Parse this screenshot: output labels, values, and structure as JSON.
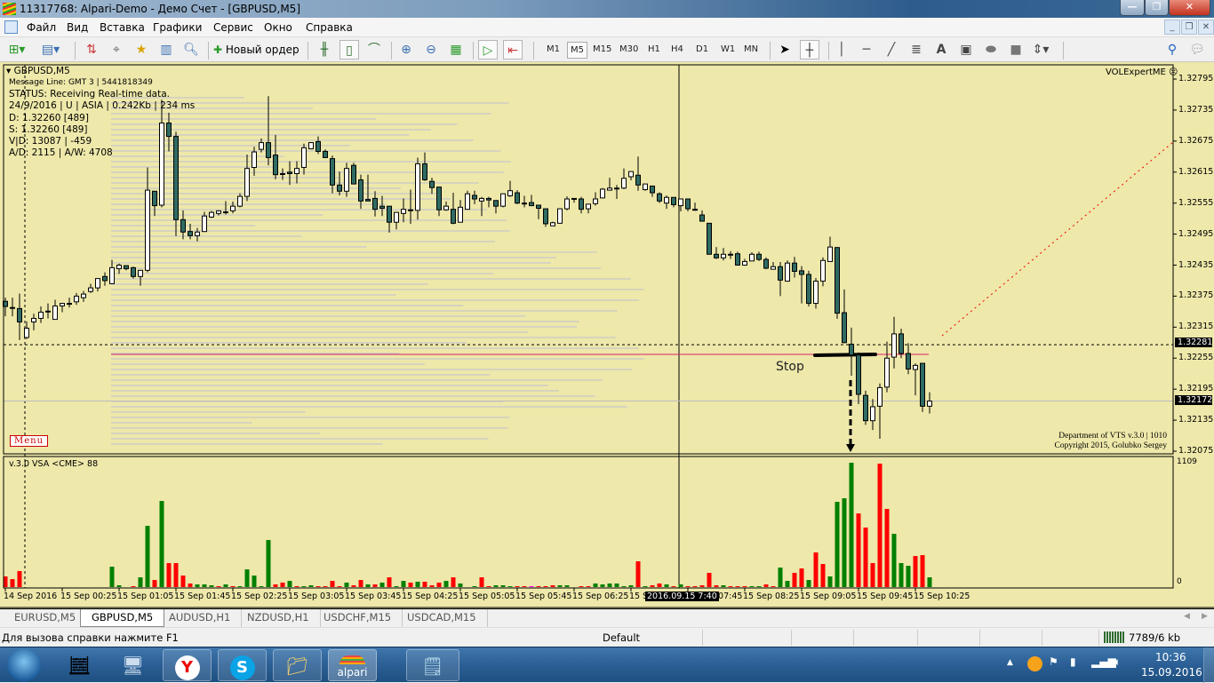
{
  "window": {
    "title": "11317768: Alpari-Demo - Демо Счет - [GBPUSD,M5]"
  },
  "menu": [
    "Файл",
    "Вид",
    "Вставка",
    "Графики",
    "Сервис",
    "Окно",
    "Справка"
  ],
  "toolbar": {
    "new_order": "Новый ордер",
    "timeframes": [
      "M1",
      "M5",
      "M15",
      "M30",
      "H1",
      "H4",
      "D1",
      "W1",
      "MN"
    ],
    "active_timeframe": "M5",
    "text_tool": "A"
  },
  "chart": {
    "symbol": "GBPUSD,M5",
    "info_lines": [
      "Message Line: GMT 3 | 5441818349",
      "STATUS:  Receiving Real-time data.",
      "24/9/2016 | U | ASIA | 0.242Kb | 234 ms",
      "D: 1.32260  [489]",
      "S: 1.32260  [489]",
      "V|D: 13087 | -459",
      "A/D: 2115 | A/W: 4708"
    ],
    "expert": "VOLExpertME",
    "expert_face": "☹",
    "menu_button": "Menu",
    "stop_label": "Stop",
    "credits": [
      "Department of VTS  v.3.0 | 1010",
      "Copyright 2015, Golubko Sergey"
    ],
    "volume_title": "v.3.0 VSA <CME> 88",
    "volume_max_label": "1109",
    "volume_zero_label": "0",
    "price_labels": [
      "1.32795",
      "1.32735",
      "1.32675",
      "1.32615",
      "1.32555",
      "1.32495",
      "1.32435",
      "1.32375",
      "1.32315",
      "1.32255",
      "1.32195",
      "1.32135",
      "1.32075"
    ],
    "ask_price": "1.32281",
    "bid_price": "1.32172",
    "time_labels": [
      "14 Sep 2016",
      "15 Sep 00:25",
      "15 Sep 01:05",
      "15 Sep 01:45",
      "15 Sep 02:25",
      "15 Sep 03:05",
      "15 Sep 03:45",
      "15 Sep 04:25",
      "15 Sep 05:05",
      "15 Sep 05:45",
      "15 Sep 06:25",
      "15 Sep 07:05",
      "15 Sep 07:45",
      "15 Sep 08:25",
      "15 Sep 09:05",
      "15 Sep 09:45",
      "15 Sep 10:25"
    ],
    "crosshair_time": "2016.09.15 7:40",
    "colors": {
      "background": "#eee8aa",
      "bull": "#ffffff",
      "bear": "#2f6b63",
      "vol_up": "#008000",
      "vol_down": "#ff0000",
      "vol_neutral": "#ff00ff"
    }
  },
  "chart_data": {
    "type": "candlestick",
    "symbol": "GBPUSD",
    "timeframe": "M5",
    "ylim": [
      1.32075,
      1.32795
    ],
    "ohlc": [
      [
        1.32365,
        1.32372,
        1.32336,
        1.32355
      ],
      [
        1.32353,
        1.32372,
        1.32336,
        1.32352
      ],
      [
        1.32351,
        1.3238,
        1.3229,
        1.32325
      ],
      [
        1.32295,
        1.32326,
        1.32292,
        1.32313
      ],
      [
        1.32325,
        1.32341,
        1.32309,
        1.32332
      ],
      [
        1.32332,
        1.32355,
        1.32323,
        1.32344
      ],
      [
        1.32345,
        1.32361,
        1.32332,
        1.32346
      ],
      [
        1.3233,
        1.32368,
        1.3233,
        1.32356
      ],
      [
        1.32356,
        1.32361,
        1.32344,
        1.32361
      ],
      [
        1.32361,
        1.32372,
        1.32353,
        1.32361
      ],
      [
        1.32364,
        1.32381,
        1.32358,
        1.32375
      ],
      [
        1.32372,
        1.32385,
        1.32364,
        1.32379
      ],
      [
        1.32384,
        1.32399,
        1.32381,
        1.32391
      ],
      [
        1.32391,
        1.32409,
        1.32384,
        1.32409
      ],
      [
        1.32413,
        1.32421,
        1.32395,
        1.32405
      ],
      [
        1.32399,
        1.32445,
        1.32399,
        1.3243
      ],
      [
        1.32428,
        1.32438,
        1.32418,
        1.32435
      ],
      [
        1.32434,
        1.32434,
        1.32425,
        1.32428
      ],
      [
        1.3243,
        1.32432,
        1.32409,
        1.32413
      ],
      [
        1.32413,
        1.32425,
        1.32395,
        1.32425
      ],
      [
        1.32425,
        1.32624,
        1.32421,
        1.3258
      ],
      [
        1.32578,
        1.32578,
        1.3253,
        1.3255
      ],
      [
        1.32551,
        1.32755,
        1.32547,
        1.3271
      ],
      [
        1.3271,
        1.3273,
        1.32655,
        1.32684
      ],
      [
        1.32684,
        1.32693,
        1.32491,
        1.32523
      ],
      [
        1.32523,
        1.32541,
        1.32485,
        1.32499
      ],
      [
        1.325,
        1.32515,
        1.32485,
        1.32492
      ],
      [
        1.32492,
        1.32507,
        1.32481,
        1.32499
      ],
      [
        1.325,
        1.32538,
        1.32499,
        1.3253
      ],
      [
        1.32528,
        1.3254,
        1.32526,
        1.32537
      ],
      [
        1.32535,
        1.32541,
        1.32531,
        1.3254
      ],
      [
        1.32538,
        1.32559,
        1.32533,
        1.32538
      ],
      [
        1.3254,
        1.32558,
        1.32535,
        1.32549
      ],
      [
        1.32549,
        1.32574,
        1.32547,
        1.32568
      ],
      [
        1.32568,
        1.32649,
        1.32559,
        1.32622
      ],
      [
        1.32624,
        1.32664,
        1.32608,
        1.32654
      ],
      [
        1.32659,
        1.3268,
        1.32653,
        1.32672
      ],
      [
        1.32672,
        1.32762,
        1.32628,
        1.32643
      ],
      [
        1.32648,
        1.32687,
        1.32601,
        1.3261
      ],
      [
        1.32612,
        1.32622,
        1.326,
        1.32612
      ],
      [
        1.32615,
        1.32636,
        1.3259,
        1.32612
      ],
      [
        1.32612,
        1.32636,
        1.32593,
        1.32622
      ],
      [
        1.32624,
        1.3267,
        1.3261,
        1.32662
      ],
      [
        1.3266,
        1.32673,
        1.32659,
        1.32672
      ],
      [
        1.32674,
        1.32684,
        1.3265,
        1.32655
      ],
      [
        1.32655,
        1.32659,
        1.32643,
        1.32643
      ],
      [
        1.32641,
        1.32647,
        1.32574,
        1.3259
      ],
      [
        1.3259,
        1.32616,
        1.3257,
        1.32578
      ],
      [
        1.32578,
        1.32633,
        1.32567,
        1.32622
      ],
      [
        1.32628,
        1.32633,
        1.32592,
        1.32592
      ],
      [
        1.326,
        1.3261,
        1.32544,
        1.32559
      ],
      [
        1.32562,
        1.3261,
        1.32559,
        1.32559
      ],
      [
        1.32564,
        1.32578,
        1.32529,
        1.32543
      ],
      [
        1.32549,
        1.32569,
        1.3253,
        1.32545
      ],
      [
        1.32549,
        1.32549,
        1.32498,
        1.32518
      ],
      [
        1.32518,
        1.32537,
        1.32504,
        1.32537
      ],
      [
        1.32535,
        1.32564,
        1.32518,
        1.32543
      ],
      [
        1.32542,
        1.32581,
        1.32515,
        1.32542
      ],
      [
        1.32541,
        1.32643,
        1.32523,
        1.32631
      ],
      [
        1.32631,
        1.32653,
        1.32598,
        1.326
      ],
      [
        1.32597,
        1.32604,
        1.32573,
        1.32585
      ],
      [
        1.32586,
        1.32586,
        1.3253,
        1.32542
      ],
      [
        1.32542,
        1.32558,
        1.3254,
        1.32549
      ],
      [
        1.32543,
        1.32575,
        1.32514,
        1.32516
      ],
      [
        1.32518,
        1.32561,
        1.32518,
        1.32547
      ],
      [
        1.32543,
        1.32579,
        1.32543,
        1.32573
      ],
      [
        1.3257,
        1.32579,
        1.32553,
        1.32563
      ],
      [
        1.32559,
        1.32567,
        1.3253,
        1.32564
      ],
      [
        1.32564,
        1.32567,
        1.32547,
        1.32561
      ],
      [
        1.3256,
        1.3256,
        1.32535,
        1.32549
      ],
      [
        1.32549,
        1.32573,
        1.32547,
        1.32573
      ],
      [
        1.32569,
        1.32598,
        1.32567,
        1.32579
      ],
      [
        1.32575,
        1.3258,
        1.32553,
        1.32555
      ],
      [
        1.32555,
        1.32569,
        1.32547,
        1.32555
      ],
      [
        1.32556,
        1.32571,
        1.32549,
        1.3255
      ],
      [
        1.32551,
        1.32551,
        1.32524,
        1.32545
      ],
      [
        1.32544,
        1.32544,
        1.32509,
        1.32515
      ],
      [
        1.32511,
        1.32519,
        1.32511,
        1.32517
      ],
      [
        1.32516,
        1.32544,
        1.32516,
        1.32544
      ],
      [
        1.32544,
        1.32568,
        1.32541,
        1.32563
      ],
      [
        1.32564,
        1.32564,
        1.32556,
        1.32564
      ],
      [
        1.32563,
        1.32567,
        1.32535,
        1.32543
      ],
      [
        1.32544,
        1.32553,
        1.32535,
        1.32553
      ],
      [
        1.32554,
        1.32576,
        1.3255,
        1.32563
      ],
      [
        1.32565,
        1.32584,
        1.32564,
        1.32582
      ],
      [
        1.3258,
        1.32604,
        1.3258,
        1.32584
      ],
      [
        1.32584,
        1.3259,
        1.32563,
        1.32584
      ],
      [
        1.32584,
        1.32622,
        1.32582,
        1.32603
      ],
      [
        1.32606,
        1.32616,
        1.32599,
        1.32616
      ],
      [
        1.32609,
        1.32645,
        1.32579,
        1.3259
      ],
      [
        1.32581,
        1.32592,
        1.32579,
        1.32592
      ],
      [
        1.32588,
        1.32588,
        1.32567,
        1.32575
      ],
      [
        1.32573,
        1.32576,
        1.32555,
        1.32559
      ],
      [
        1.32555,
        1.3257,
        1.32544,
        1.32566
      ],
      [
        1.32566,
        1.32566,
        1.32547,
        1.32552
      ],
      [
        1.3255,
        1.32563,
        1.32539,
        1.32563
      ],
      [
        1.32563,
        1.32563,
        1.32539,
        1.32544
      ],
      [
        1.32543,
        1.32556,
        1.3254,
        1.32543
      ],
      [
        1.32532,
        1.32541,
        1.32519,
        1.3252
      ],
      [
        1.32516,
        1.32516,
        1.32456,
        1.32456
      ],
      [
        1.32456,
        1.3247,
        1.32447,
        1.32449
      ],
      [
        1.32449,
        1.32468,
        1.32444,
        1.32456
      ],
      [
        1.32456,
        1.32462,
        1.32447,
        1.32456
      ],
      [
        1.32457,
        1.32461,
        1.32435,
        1.32435
      ],
      [
        1.32435,
        1.32447,
        1.32434,
        1.32442
      ],
      [
        1.32443,
        1.3246,
        1.32443,
        1.32456
      ],
      [
        1.32456,
        1.32461,
        1.32443,
        1.32446
      ],
      [
        1.32446,
        1.3245,
        1.32427,
        1.32429
      ],
      [
        1.32427,
        1.32441,
        1.32427,
        1.32432
      ],
      [
        1.32432,
        1.32441,
        1.32375,
        1.32406
      ],
      [
        1.32404,
        1.32444,
        1.32403,
        1.32439
      ],
      [
        1.32439,
        1.32451,
        1.32411,
        1.32423
      ],
      [
        1.32424,
        1.32433,
        1.32361,
        1.32417
      ],
      [
        1.32417,
        1.32424,
        1.32355,
        1.32361
      ],
      [
        1.32361,
        1.3241,
        1.32351,
        1.32404
      ],
      [
        1.32404,
        1.3245,
        1.32394,
        1.32444
      ],
      [
        1.32442,
        1.3249,
        1.32442,
        1.3247
      ],
      [
        1.32469,
        1.3247,
        1.32331,
        1.32342
      ],
      [
        1.32343,
        1.32388,
        1.32284,
        1.32285
      ],
      [
        1.32282,
        1.32314,
        1.32221,
        1.32261
      ],
      [
        1.32261,
        1.32266,
        1.32166,
        1.32185
      ],
      [
        1.32183,
        1.32192,
        1.32126,
        1.32134
      ],
      [
        1.32134,
        1.32176,
        1.32116,
        1.32161
      ],
      [
        1.32162,
        1.32206,
        1.32099,
        1.32198
      ],
      [
        1.32199,
        1.32287,
        1.32189,
        1.32255
      ],
      [
        1.32257,
        1.32335,
        1.32235,
        1.32302
      ],
      [
        1.32302,
        1.32312,
        1.32255,
        1.32264
      ],
      [
        1.32264,
        1.32284,
        1.32224,
        1.32234
      ],
      [
        1.32233,
        1.32245,
        1.32183,
        1.32241
      ],
      [
        1.32245,
        1.32245,
        1.32151,
        1.32162
      ],
      [
        1.32162,
        1.32189,
        1.32148,
        1.32172
      ]
    ],
    "volume_max": 1109,
    "volumes": [
      95,
      71,
      143,
      0,
      0,
      0,
      0,
      0,
      0,
      0,
      0,
      0,
      0,
      0,
      0,
      182,
      16,
      0,
      3,
      87,
      546,
      63,
      768,
      214,
      214,
      103,
      32,
      24,
      24,
      16,
      3,
      24,
      8,
      8,
      158,
      103,
      8,
      420,
      24,
      40,
      55,
      8,
      3,
      16,
      3,
      3,
      55,
      8,
      40,
      16,
      63,
      24,
      24,
      40,
      87,
      8,
      55,
      40,
      48,
      48,
      16,
      40,
      55,
      87,
      32,
      0,
      8,
      87,
      8,
      16,
      16,
      3,
      3,
      8,
      8,
      8,
      8,
      16,
      16,
      16,
      0,
      3,
      8,
      32,
      24,
      32,
      32,
      3,
      16,
      230,
      3,
      16,
      32,
      24,
      3,
      24,
      8,
      8,
      16,
      127,
      16,
      16,
      3,
      3,
      3,
      8,
      3,
      24,
      3,
      174,
      55,
      127,
      166,
      63,
      309,
      206,
      95,
      760,
      792,
      1109,
      657,
      531,
      214,
      1101,
      697,
      475,
      214,
      190,
      277,
      285,
      87
    ],
    "volume_colors": "rrr000000000000gg0rggrgrrrrgggrgrgggggrrgrggrrrrgrrgrgrggrgrrrgrgrgrrgggrrmrrrggg0rggggggrgrrgrgrrrrrgrrrggrrggrrgrrggggrrrrrgggrrgrg"
  },
  "tabs": [
    "EURUSD,M5",
    "GBPUSD,M5",
    "AUDUSD,H1",
    "NZDUSD,H1",
    "USDCHF,M15",
    "USDCAD,M15"
  ],
  "active_tab": "GBPUSD,M5",
  "status": {
    "help": "Для вызова справки нажмите F1",
    "profile": "Default",
    "traffic": "7789/6 kb"
  },
  "taskbar": {
    "alpari_label": "alpari",
    "time": "10:36",
    "date": "15.09.2016"
  }
}
